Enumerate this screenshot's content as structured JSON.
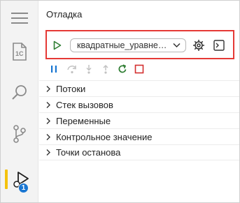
{
  "panel": {
    "title": "Отладка"
  },
  "activity_bar": {
    "items": [
      {
        "icon": "menu-icon"
      },
      {
        "icon": "file-1c-icon",
        "text": "1С"
      },
      {
        "icon": "search-icon"
      },
      {
        "icon": "source-control-icon"
      },
      {
        "icon": "run-debug-icon",
        "badge": "1",
        "active": true
      }
    ]
  },
  "launch": {
    "run_icon": "play-icon",
    "configuration": "квадратные_уравнения",
    "settings_icon": "gear-icon",
    "console_icon": "terminal-icon"
  },
  "debug_toolbar": [
    "pause-icon",
    "step-over-icon",
    "step-into-icon",
    "step-out-icon",
    "restart-icon",
    "stop-icon"
  ],
  "sections": [
    {
      "label": "Потоки"
    },
    {
      "label": "Стек вызовов"
    },
    {
      "label": "Переменные"
    },
    {
      "label": "Контрольное значение"
    },
    {
      "label": "Точки останова"
    }
  ],
  "colors": {
    "accent_blue": "#1976d2",
    "run_green": "#2e7d32",
    "stop_red": "#d32f2f",
    "highlight_red": "#e53935",
    "active_marker": "#f4c20d"
  }
}
